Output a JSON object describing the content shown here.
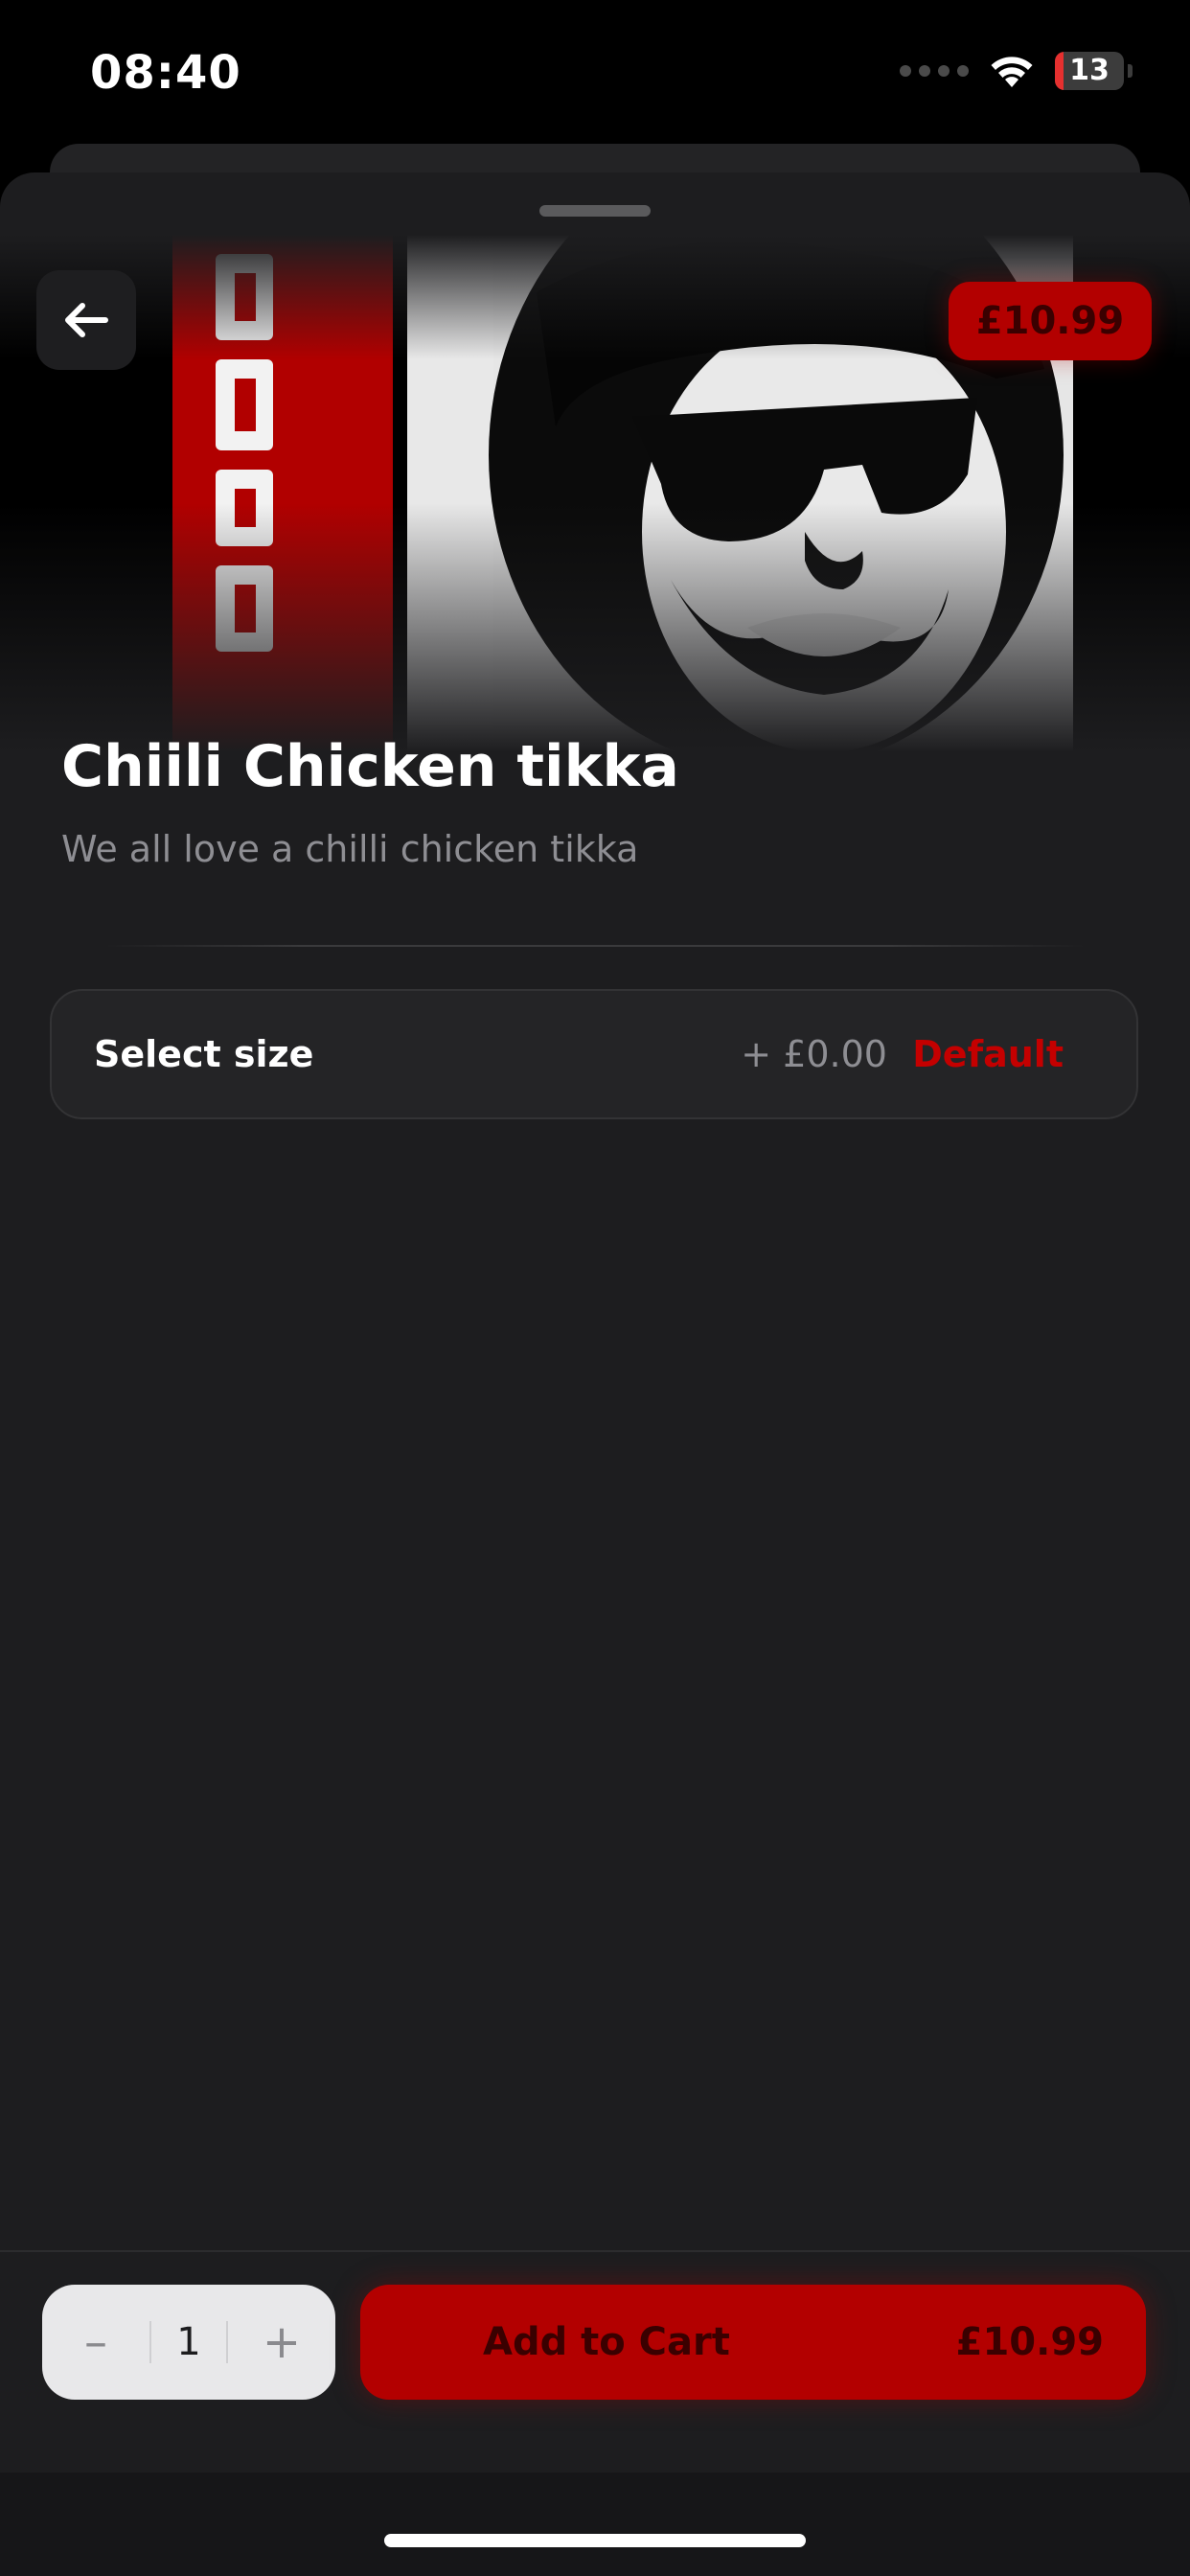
{
  "status_bar": {
    "time": "08:40",
    "battery_level": "13",
    "icons": [
      "cellular-signal-icon",
      "wifi-icon",
      "battery-icon"
    ]
  },
  "product": {
    "name": "Chiili Chicken tikka",
    "description": "We all love a chilli chicken tikka",
    "price": "£10.99",
    "image": "product-hero-image"
  },
  "options": [
    {
      "label": "Select size",
      "price_delta": "+ £0.00",
      "selection": "Default"
    }
  ],
  "cart": {
    "quantity": "1",
    "decrement_glyph": "–",
    "increment_glyph": "+",
    "add_label": "Add to Cart",
    "total": "£10.99"
  },
  "colors": {
    "accent": "#b30000",
    "background": "#1d1d1f",
    "text_primary": "#ffffff",
    "text_secondary": "#8e8e93"
  }
}
